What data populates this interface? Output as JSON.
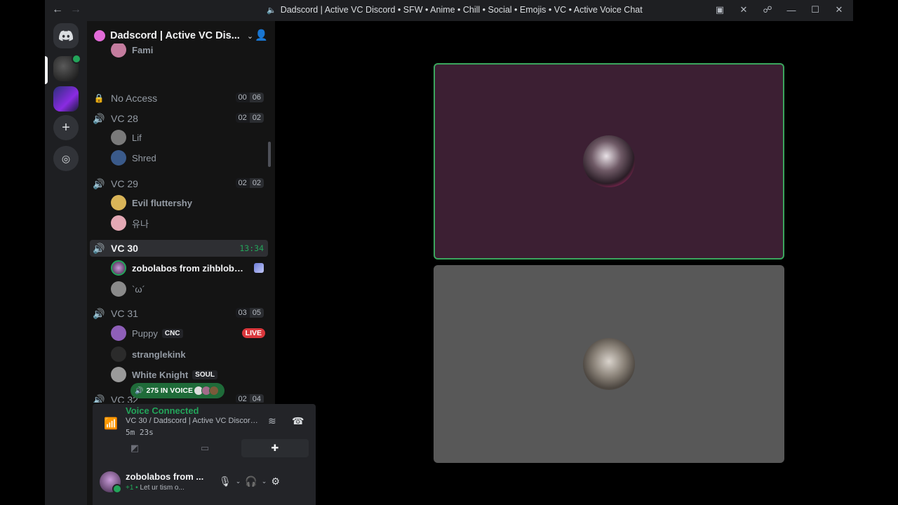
{
  "window": {
    "title": "Dadscord | Active VC Discord • SFW • Anime • Chill • Social • Emojis • VC • Active Voice Chat"
  },
  "server": {
    "name": "Dadscord | Active VC Dis..."
  },
  "channels": [
    {
      "name": "No Access",
      "cap_current": "00",
      "cap_max": "06",
      "locked": true,
      "users": []
    },
    {
      "name": "VC 28",
      "cap_current": "02",
      "cap_max": "02",
      "users": [
        {
          "name": "Lif"
        },
        {
          "name": "Shred"
        }
      ]
    },
    {
      "name": "VC 29",
      "cap_current": "02",
      "cap_max": "02",
      "users": [
        {
          "name": "Evil fluttershy"
        },
        {
          "name": "유나"
        }
      ]
    },
    {
      "name": "VC 30",
      "timer": "13:34",
      "active": true,
      "users": [
        {
          "name": "zobolabos from zihblobeela..."
        },
        {
          "name": "`ω´"
        }
      ]
    },
    {
      "name": "VC 31",
      "cap_current": "03",
      "cap_max": "05",
      "users": [
        {
          "name": "Puppy",
          "tag": "CNC"
        },
        {
          "name": "stranglekink"
        },
        {
          "name": "White Knight",
          "tag": "SOUL"
        }
      ]
    },
    {
      "name": "VC 32",
      "cap_current": "02",
      "cap_max": "04",
      "users": []
    }
  ],
  "partial_top_user": "Fami",
  "live_badge": "LIVE",
  "voice_pill": "275 IN VOICE",
  "voice_connected": {
    "status": "Voice Connected",
    "detail": "VC 30 / Dadscord | Active VC Discord ...",
    "elapsed": "5m 23s"
  },
  "user_panel": {
    "name": "zobolabos from ...",
    "status_prefix": "+1 •",
    "status": "Let ur tism o..."
  },
  "colors": {
    "voice_green": "#23a55a",
    "live_red": "#da373c",
    "speaking_border": "#3ba55d",
    "tile_a_bg": "#3c1f33",
    "tile_b_bg": "#585858"
  },
  "icons": [
    "discord-home-icon",
    "add-server-icon",
    "explore-icon",
    "speaker-icon",
    "lock-icon",
    "add-member-icon",
    "signal-icon",
    "noise-suppression-icon",
    "disconnect-icon",
    "camera-off-icon",
    "screenshare-icon",
    "activities-icon",
    "microphone-icon",
    "headphones-icon",
    "gear-icon"
  ]
}
